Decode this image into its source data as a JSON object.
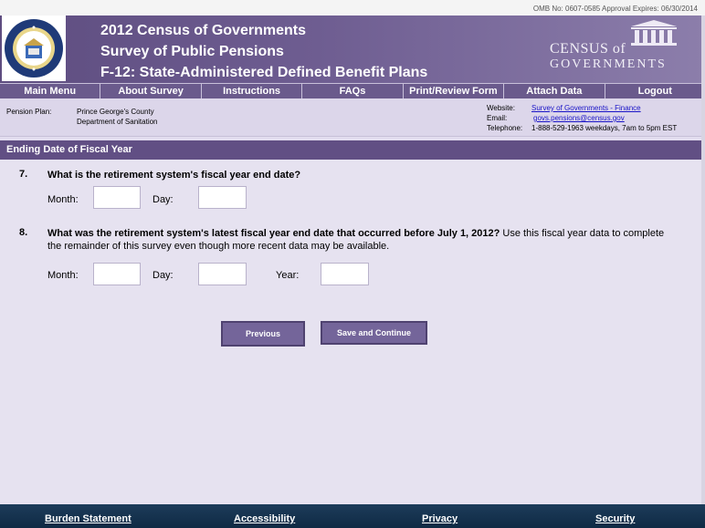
{
  "omb": {
    "text": "OMB No:  0607-0585   Approval Expires:  06/30/2014"
  },
  "header": {
    "title_line1": "2012 Census of Governments",
    "title_line2": "Survey of Public Pensions",
    "title_line3": "F-12:  State-Administered Defined Benefit Plans",
    "logo_line1": "CENSUS of",
    "logo_line2": "GOVERNMENTS",
    "seal_icon": "dept-of-commerce-seal-icon"
  },
  "nav": {
    "items": [
      "Main Menu",
      "About Survey",
      "Instructions",
      "FAQs",
      "Print/Review Form",
      "Attach Data",
      "Logout"
    ]
  },
  "info": {
    "pension_plan_label": "Pension Plan:",
    "pension_plan_line1": "Prince George's County",
    "pension_plan_line2": "Department of Sanitation",
    "website_label": "Website:",
    "website_value": "Survey of Governments - Finance",
    "email_label": "Email:",
    "email_value": "govs.pensions@census.gov",
    "telephone_label": "Telephone:",
    "telephone_value": "1-888-529-1963  weekdays, 7am to 5pm EST"
  },
  "section": {
    "title": "Ending Date of Fiscal Year"
  },
  "q7": {
    "number": "7.",
    "text": "What is the retirement system's fiscal year end date?",
    "month_label": "Month:",
    "day_label": "Day:",
    "month_value": "",
    "day_value": ""
  },
  "q8": {
    "number": "8.",
    "text_bold": "What was the retirement system's latest fiscal year end date that occurred before July 1, 2012?",
    "text_rest": "  Use this fiscal year data to complete the remainder of this survey even though more recent data may be available.",
    "month_label": "Month:",
    "day_label": "Day:",
    "year_label": "Year:",
    "month_value": "",
    "day_value": "",
    "year_value": ""
  },
  "buttons": {
    "previous": "Previous",
    "save_continue": "Save and Continue"
  },
  "footer": {
    "links": [
      "Burden Statement",
      "Accessibility",
      "Privacy",
      "Security"
    ]
  },
  "colors": {
    "header": "#6e5d91",
    "section_bar": "#614f84",
    "footer": "#1d3c5a",
    "link": "#1a14c7"
  }
}
